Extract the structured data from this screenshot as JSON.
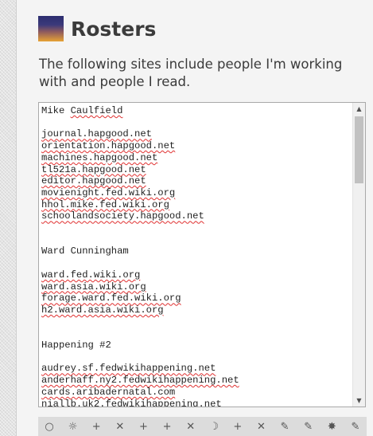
{
  "page": {
    "title": "Rosters",
    "intro": "The following sites include people I'm working with and people I read."
  },
  "roster": {
    "sections": [
      {
        "heading": "Mike Caulfield",
        "sites": [
          "journal.hapgood.net",
          "orientation.hapgood.net",
          "machines.hapgood.net",
          "tl521a.hapgood.net",
          "editor.hapgood.net",
          "movienight.fed.wiki.org",
          "hhol.mike.fed.wiki.org",
          "schoolandsociety.hapgood.net"
        ]
      },
      {
        "heading": "Ward Cunningham",
        "sites": [
          "ward.fed.wiki.org",
          "ward.asia.wiki.org",
          "forage.ward.fed.wiki.org",
          "h2.ward.asia.wiki.org"
        ]
      },
      {
        "heading": "Happening #2",
        "sites": [
          "audrey.sf.fedwikihappening.net",
          "anderhaff.ny2.fedwikihappening.net",
          "cards.aribadernatal.com",
          "niallb.uk2.fedwikihappening.net"
        ]
      }
    ]
  },
  "toolbar": {
    "icons": [
      {
        "name": "circle-icon",
        "glyph": "○"
      },
      {
        "name": "sun-icon",
        "glyph": "☼"
      },
      {
        "name": "plus-icon",
        "glyph": "+"
      },
      {
        "name": "cross-icon",
        "glyph": "✕"
      },
      {
        "name": "plus-icon",
        "glyph": "+"
      },
      {
        "name": "plus-icon",
        "glyph": "+"
      },
      {
        "name": "cross-icon",
        "glyph": "✕"
      },
      {
        "name": "moon-icon",
        "glyph": "☽"
      },
      {
        "name": "plus-icon",
        "glyph": "+"
      },
      {
        "name": "cross-icon",
        "glyph": "✕"
      },
      {
        "name": "pencil-icon",
        "glyph": "✎"
      },
      {
        "name": "pencil-icon",
        "glyph": "✎"
      },
      {
        "name": "star-icon",
        "glyph": "✸"
      },
      {
        "name": "pencil-icon",
        "glyph": "✎"
      }
    ]
  },
  "colors": {
    "page_background": "#f4f4f4",
    "text": "#3b3b3b",
    "spellcheck_underline": "#e03030"
  }
}
